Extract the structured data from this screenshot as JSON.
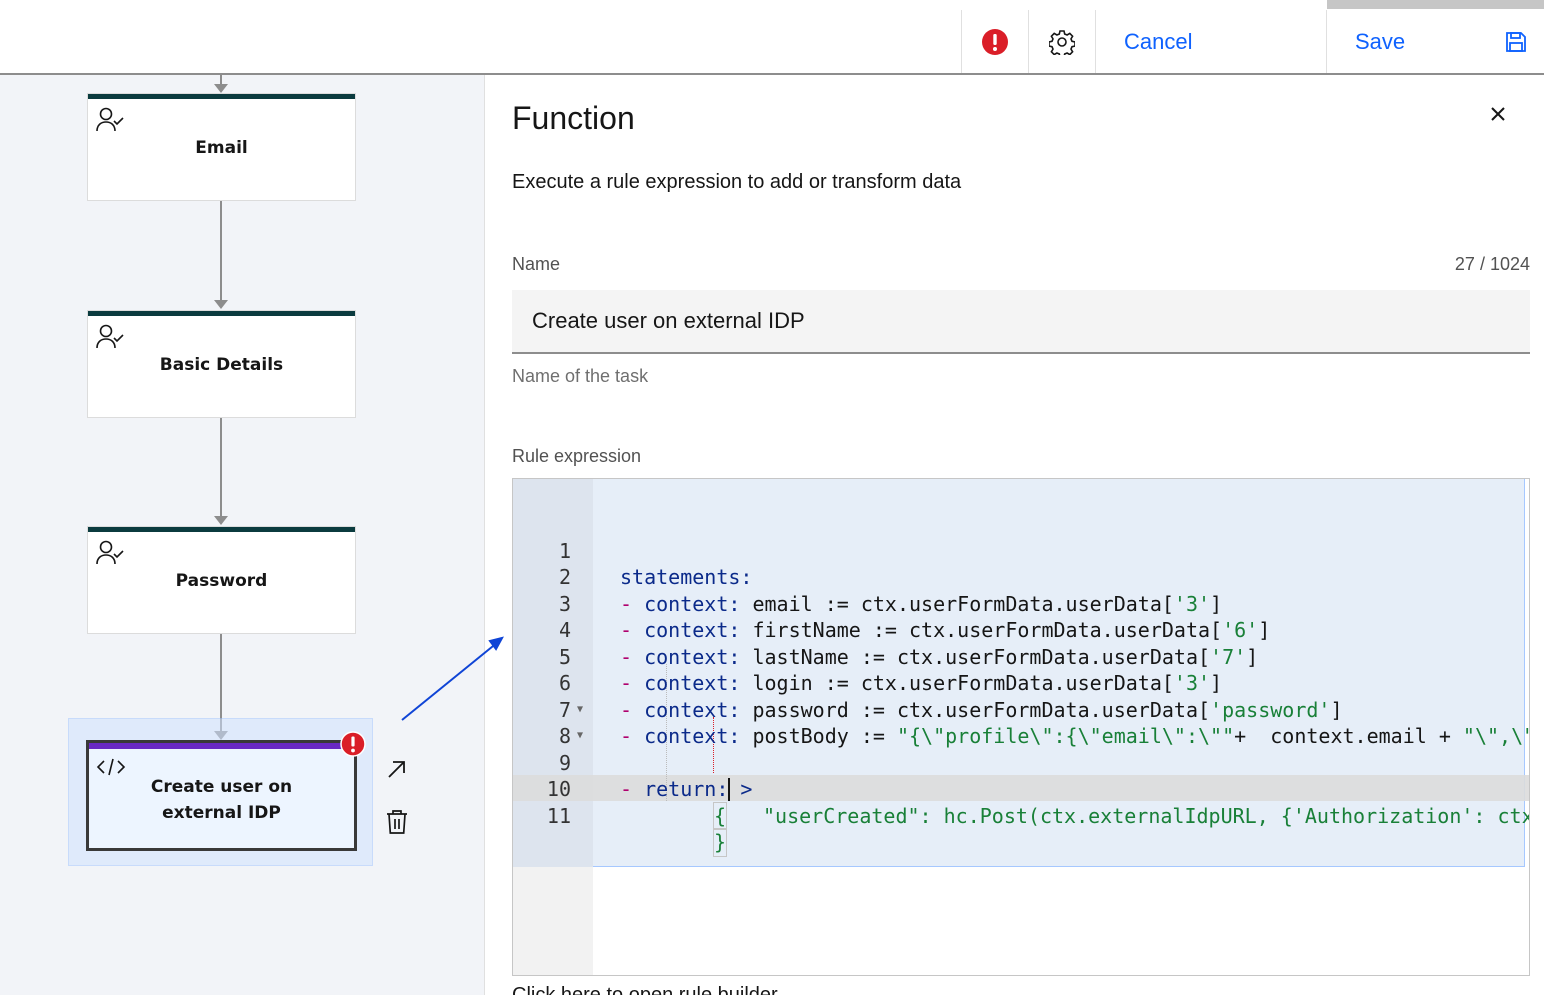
{
  "header": {
    "cancel_label": "Cancel",
    "save_label": "Save",
    "error_icon": "error-icon",
    "settings_icon": "gear-icon",
    "save_icon": "floppy-disk-icon"
  },
  "workflow": {
    "nodes": [
      {
        "title": "Email",
        "icon": "user-check-icon"
      },
      {
        "title": "Basic Details",
        "icon": "user-check-icon"
      },
      {
        "title": "Password",
        "icon": "user-check-icon"
      },
      {
        "title_line1": "Create user on",
        "title_line2": "external IDP",
        "icon": "code-icon",
        "selected": true,
        "has_error": true
      }
    ],
    "node_actions": [
      "open-arrow-icon",
      "trash-icon"
    ]
  },
  "panel": {
    "title": "Function",
    "description": "Execute a rule expression to add or transform data",
    "name_label": "Name",
    "name_counter": "27 / 1024",
    "name_value": "Create user on external IDP",
    "name_helper": "Name of the task",
    "rule_label": "Rule expression",
    "footer_hint": "Click here to open rule builder"
  },
  "code": {
    "line_numbers": [
      "1",
      "2",
      "3",
      "4",
      "5",
      "6",
      "7",
      "8",
      "9",
      "10",
      "11"
    ],
    "l1_kw": "statements:",
    "ctx_kw": "context:",
    "ret_kw": "return:",
    "dash": "- ",
    "l2_a": " email := ctx.userFormData.userData[",
    "l2_s": "'3'",
    "l3_a": " firstName := ctx.userFormData.userData[",
    "l3_s": "'6'",
    "l4_a": " lastName := ctx.userFormData.userData[",
    "l4_s": "'7'",
    "l5_a": " login := ctx.userFormData.userData[",
    "l5_s": "'3'",
    "l6_a": " password := ctx.userFormData.userData[",
    "l6_s": "'password'",
    "close_bracket": "]",
    "l7_a": " postBody := ",
    "l7_s1": "\"{\\\"profile\\\":{\\\"email\\\":\\\"\"",
    "l7_b": "+  context.email + ",
    "l7_s2": "\"\\\",\\\"firstName\\\"",
    "l8_gt": " >",
    "l9": "{",
    "l10_s": "\"userCreated\"",
    "l10_b": ": hc.Post(ctx.externalIdpURL, {'Authorization': ctx.",
    "l11": "}"
  }
}
